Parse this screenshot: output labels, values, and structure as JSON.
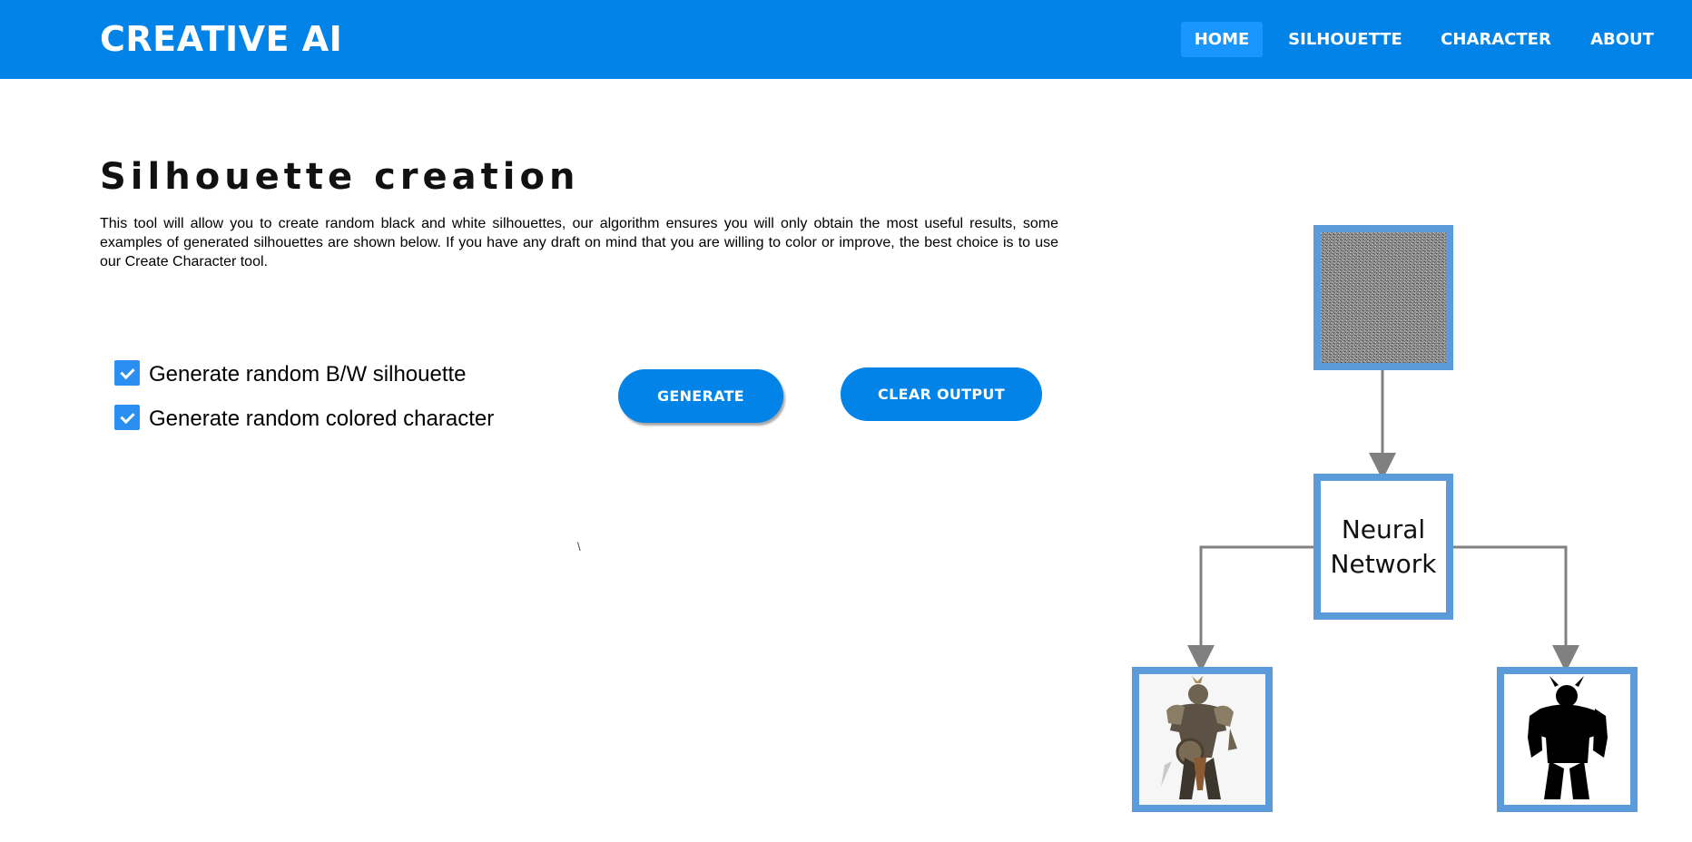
{
  "header": {
    "brand": "CREATIVE AI",
    "nav": [
      {
        "label": "HOME",
        "active": true
      },
      {
        "label": "SILHOUETTE",
        "active": false
      },
      {
        "label": "CHARACTER",
        "active": false
      },
      {
        "label": "ABOUT",
        "active": false
      }
    ]
  },
  "main": {
    "title": "Silhouette creation",
    "description": "This tool will allow you to create random black and white silhouettes, our algorithm ensures you will only obtain the most useful results, some examples of generated silhouettes are shown below. If you have any draft on mind that you are willing to color or improve, the best choice is to use our Create Character tool.",
    "options": [
      {
        "label": "Generate random B/W silhouette",
        "checked": true
      },
      {
        "label": "Generate random colored character",
        "checked": true
      }
    ],
    "generate_label": "GENERATE",
    "clear_label": "CLEAR OUTPUT",
    "stray_text": "\\"
  },
  "diagram": {
    "node_label_line1": "Neural",
    "node_label_line2": "Network",
    "icons": [
      "noise-image",
      "armored-warrior-image",
      "black-silhouette-image"
    ]
  },
  "colors": {
    "navbar": "#0183e8",
    "nav_active": "#1a97ff",
    "button": "#0183e8",
    "checkbox": "#2a8ff0",
    "diagram_border": "#5b9bd9",
    "arrow": "#808080"
  }
}
